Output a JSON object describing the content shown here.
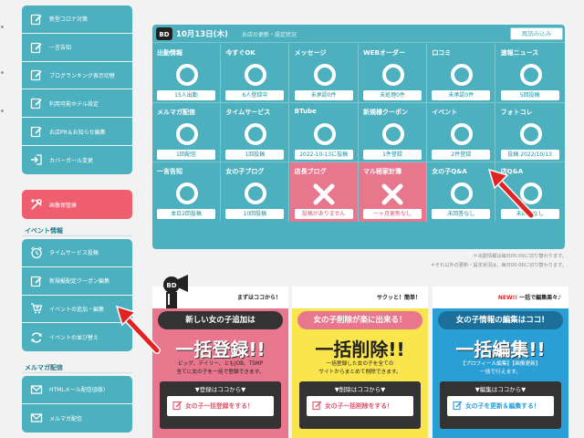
{
  "sidebar": {
    "group1": [
      {
        "label": "新型コロナ対策",
        "icon": "edit-icon"
      },
      {
        "label": "一言告知",
        "icon": "edit-icon"
      },
      {
        "label": "ブログランキング表示切替",
        "icon": "edit-icon"
      },
      {
        "label": "利用可能ホテル設定",
        "icon": "edit-icon"
      },
      {
        "label": "お店PR＆お知らせ編集",
        "icon": "edit-icon"
      },
      {
        "label": "カバーガール変更",
        "icon": "login-icon"
      }
    ],
    "image_storage": "画像保管庫",
    "event_section": "イベント情報",
    "group2": [
      {
        "label": "タイムサービス投稿",
        "icon": "alarm-clock-icon"
      },
      {
        "label": "新規擬配定クーポン編集",
        "icon": "edit-icon"
      },
      {
        "label": "イベントの追加・編集",
        "icon": "cart-plus-icon"
      },
      {
        "label": "イベントの並び替え",
        "icon": "refresh-icon"
      }
    ],
    "mailmag_section": "メルマガ配信",
    "group3": [
      {
        "label": "HTMLメール配信(β版)",
        "icon": "mail-icon"
      },
      {
        "label": "メルマガ配信",
        "icon": "mail-icon"
      }
    ]
  },
  "panel": {
    "date": "10月13日(木)",
    "subtitle": "お店の更新・設定状況",
    "reload": "再読み込み",
    "cells": [
      {
        "title": "出勤情報",
        "status": "15人出勤",
        "mark": "ok"
      },
      {
        "title": "今すぐOK",
        "status": "6人登録中",
        "mark": "ok"
      },
      {
        "title": "メッセージ",
        "status": "未承認0件",
        "mark": "ok"
      },
      {
        "title": "WEBオーダー",
        "status": "未処理0件",
        "mark": "ok"
      },
      {
        "title": "口コミ",
        "status": "未承認0件",
        "mark": "ok"
      },
      {
        "title": "速報ニュース",
        "status": "5回投稿",
        "mark": "ok"
      },
      {
        "title": "メルマガ配信",
        "status": "1回配信",
        "mark": "ok"
      },
      {
        "title": "タイムサービス",
        "status": "1回投稿",
        "mark": "ok"
      },
      {
        "title": "BTube",
        "status": "2022-10-13に投稿",
        "mark": "ok"
      },
      {
        "title": "新規様クーポン",
        "status": "1件登録",
        "mark": "ok"
      },
      {
        "title": "イベント",
        "status": "2件登録",
        "mark": "ok"
      },
      {
        "title": "フォトコレ",
        "status": "投稿 2022/10/13",
        "mark": "ok"
      },
      {
        "title": "一言告知",
        "status": "本日2回投稿",
        "mark": "ok"
      },
      {
        "title": "女の子ブログ",
        "status": "10回投稿",
        "mark": "ok"
      },
      {
        "title": "店長ブログ",
        "status": "投稿がありません",
        "mark": "ng"
      },
      {
        "title": "マル秘家計簿",
        "status": "一ヶ月更新なし",
        "mark": "ng"
      },
      {
        "title": "女の子Q&A",
        "status": "未回答なし",
        "mark": "ok"
      },
      {
        "title": "店Q&A",
        "status": "未回答なし",
        "mark": "ok"
      }
    ],
    "note1": "＊出勤情報は毎日05:00に切り替わります。",
    "note2": "＊それ以外の更新・設定状況は、毎日00:00に切り替わります。"
  },
  "banners": [
    {
      "small": "まずはココから！",
      "bubble": "新しい女の子追加は",
      "big": "一括登録!!",
      "desc1": "ビッグ、デイリー、ともJOB、TSMP",
      "desc2": "全てに女の子を一括で登録できます。",
      "cta_label": "▼登録はココから▼",
      "cta": "女の子一括登録をする！"
    },
    {
      "small": "サクッと！簡単！",
      "bubble": "女の子削除が楽に出来る！",
      "big": "一括削除!!",
      "desc1": "一括登録した女の子を全ての",
      "desc2": "サイトからまとめて削除できます。",
      "cta_label": "▼削除はココから▼",
      "cta": "女の子一括削除をする！"
    },
    {
      "small_new": "NEW!!",
      "small": "一括で編集楽々♪",
      "bubble": "女の子情報の編集はココ!",
      "big": "一括編集!!",
      "desc1": "【プロフィール編集】【画像更新】",
      "desc2": "一括で行えます。",
      "cta_label": "▼編集はココから▼",
      "cta": "女の子を更新＆編集する！"
    }
  ],
  "colors": {
    "teal": "#4db0bf",
    "pink": "#e8778e",
    "yellow": "#fbe54c",
    "blue": "#2a9fd6",
    "arrow": "#e02424"
  }
}
